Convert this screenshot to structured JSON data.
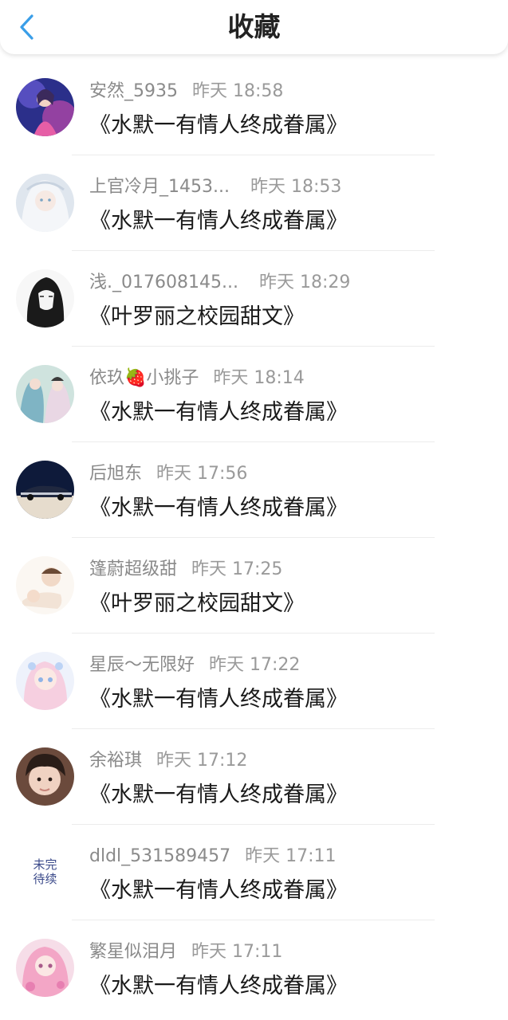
{
  "header": {
    "title": "收藏",
    "back_icon": "chevron-left-icon",
    "accent": "#3a9ee8"
  },
  "items": [
    {
      "user": "安然_5935",
      "time": "昨天 18:58",
      "book": "《水默一有情人终成眷属》"
    },
    {
      "user": "上官冷月_1453...",
      "time": "昨天 18:53",
      "book": "《水默一有情人终成眷属》"
    },
    {
      "user": "浅._017608145...",
      "time": "昨天 18:29",
      "book": "《叶罗丽之校园甜文》"
    },
    {
      "user": "依玖🍓小挑子",
      "time": "昨天 18:14",
      "book": "《水默一有情人终成眷属》"
    },
    {
      "user": "后旭东",
      "time": "昨天 17:56",
      "book": "《水默一有情人终成眷属》"
    },
    {
      "user": "篷蔚超级甜",
      "time": "昨天 17:25",
      "book": "《叶罗丽之校园甜文》"
    },
    {
      "user": "星辰～无限好",
      "time": "昨天 17:22",
      "book": "《水默一有情人终成眷属》"
    },
    {
      "user": "余裕琪",
      "time": "昨天 17:12",
      "book": "《水默一有情人终成眷属》"
    },
    {
      "user": "dldl_531589457",
      "time": "昨天 17:11",
      "book": "《水默一有情人终成眷属》"
    },
    {
      "user": "繁星似泪月",
      "time": "昨天 17:11",
      "book": "《水默一有情人终成眷属》"
    }
  ],
  "avatar_text": {
    "dldl_avatar": "未完待续"
  }
}
